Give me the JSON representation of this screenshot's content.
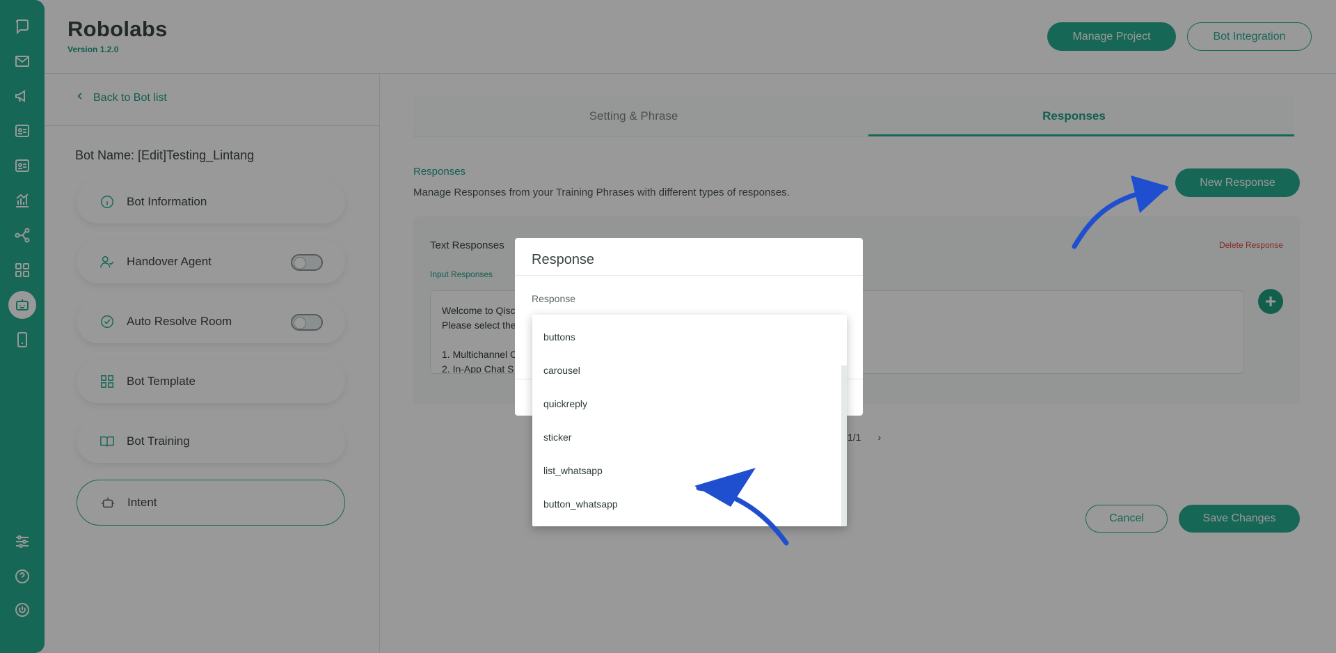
{
  "app": {
    "title": "Robolabs",
    "version": "Version 1.2.0"
  },
  "header": {
    "manage_project": "Manage Project",
    "bot_integration": "Bot Integration"
  },
  "rail": {
    "icons": [
      "chat-icon",
      "mail-icon",
      "megaphone-icon",
      "contacts-icon",
      "contacts-list-icon",
      "analytics-icon",
      "integration-icon",
      "apps-icon",
      "bot-icon",
      "mobile-icon",
      "settings-sliders-icon",
      "help-icon",
      "power-icon"
    ]
  },
  "left": {
    "back": "Back to Bot list",
    "bot_name": "Bot Name: [Edit]Testing_Lintang",
    "items": [
      {
        "label": "Bot Information"
      },
      {
        "label": "Handover Agent"
      },
      {
        "label": "Auto Resolve Room"
      },
      {
        "label": "Bot Template"
      },
      {
        "label": "Bot Training"
      },
      {
        "label": "Intent"
      }
    ]
  },
  "tabs": {
    "setting": "Setting & Phrase",
    "responses": "Responses"
  },
  "responses": {
    "title": "Responses",
    "description": "Manage Responses from your Training Phrases with different types of responses.",
    "new_button": "New Response",
    "card_label": "Text Responses",
    "input_label": "Input Responses",
    "delete": "Delete Response",
    "text_lines": [
      "Welcome to Qisc",
      "Please select the",
      "",
      "1. Multichannel C",
      "2. In-App Chat S"
    ]
  },
  "pager": {
    "page": "1/1",
    "next": "›"
  },
  "footer": {
    "cancel": "Cancel",
    "save": "Save Changes"
  },
  "modal": {
    "title": "Response",
    "field_label": "Response"
  },
  "dropdown": {
    "options": [
      "buttons",
      "carousel",
      "quickreply",
      "sticker",
      "list_whatsapp",
      "button_whatsapp"
    ]
  },
  "colors": {
    "accent": "#27ac8f",
    "arrow": "#1f4fcf",
    "danger": "#e04545"
  }
}
